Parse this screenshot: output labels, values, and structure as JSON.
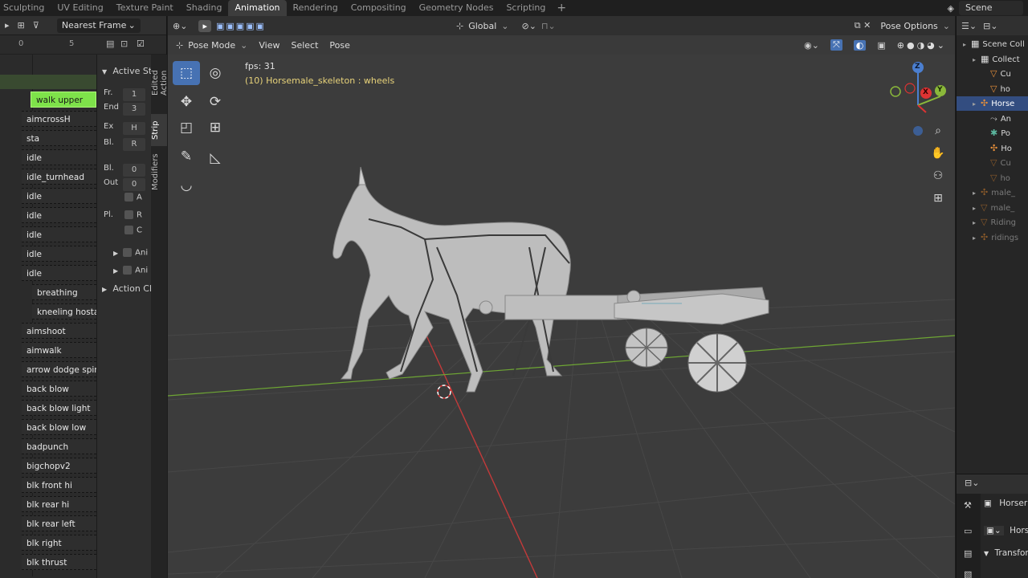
{
  "workspace_tabs": [
    "Sculpting",
    "UV Editing",
    "Texture Paint",
    "Shading",
    "Animation",
    "Rendering",
    "Compositing",
    "Geometry Nodes",
    "Scripting"
  ],
  "active_workspace": "Animation",
  "scene": {
    "label": "Scene"
  },
  "nla": {
    "snap_mode": "Nearest Frame",
    "ruler": [
      "0",
      "5"
    ],
    "tracks": [
      {
        "label": "walk upper",
        "style": "green"
      },
      {
        "label": "aimcrossH",
        "style": "normal"
      },
      {
        "label": "sta",
        "style": "normal"
      },
      {
        "label": "idle",
        "style": "normal"
      },
      {
        "label": "idle_turnhead",
        "style": "normal"
      },
      {
        "label": "idle",
        "style": "normal"
      },
      {
        "label": "idle",
        "style": "normal"
      },
      {
        "label": "idle",
        "style": "normal"
      },
      {
        "label": "idle",
        "style": "normal"
      },
      {
        "label": "idle",
        "style": "normal"
      },
      {
        "label": "breathing",
        "style": "indent"
      },
      {
        "label": "kneeling hostag",
        "style": "indent"
      },
      {
        "label": "aimshoot",
        "style": "normal"
      },
      {
        "label": "aimwalk",
        "style": "normal"
      },
      {
        "label": "arrow dodge spin 2",
        "style": "normal"
      },
      {
        "label": "back blow",
        "style": "normal"
      },
      {
        "label": "back blow light",
        "style": "normal"
      },
      {
        "label": "back blow low",
        "style": "normal"
      },
      {
        "label": "badpunch",
        "style": "normal"
      },
      {
        "label": "bigchopv2",
        "style": "normal"
      },
      {
        "label": "blk front hi",
        "style": "normal"
      },
      {
        "label": "blk rear hi",
        "style": "normal"
      },
      {
        "label": "blk rear left",
        "style": "normal"
      },
      {
        "label": "blk right",
        "style": "normal"
      },
      {
        "label": "blk thrust",
        "style": "normal"
      }
    ],
    "sidebar": {
      "active_strip_label": "Active St",
      "frame_start_label": "Fr.",
      "frame_start": "1",
      "frame_end_label": "End",
      "frame_end": "3",
      "extrapolation_label": "Ex",
      "extrapolation": "H",
      "blending_label": "Bl.",
      "blending": "R",
      "blend_in_label": "Bl.",
      "blend_in": "0",
      "blend_out_label": "Out",
      "blend_out": "0",
      "auto_blend": "A",
      "playback_label": "Pl.",
      "reversed": "R",
      "cyclic": "C",
      "anim1": "Ani",
      "anim2": "Ani",
      "action_clip_label": "Action Cli"
    },
    "vertical_tabs": [
      "Edited Action",
      "Strip",
      "Modifiers"
    ]
  },
  "viewport": {
    "orientation": "Global",
    "pose_options": "Pose Options",
    "mode": "Pose Mode",
    "menu": [
      "View",
      "Select",
      "Pose"
    ],
    "fps": "fps: 31",
    "object_info": "(10) Horsemale_skeleton : wheels",
    "gizmo_axes": {
      "z": "Z",
      "x": "X",
      "y": "Y"
    }
  },
  "outliner": {
    "rows": [
      {
        "label": "Scene Coll",
        "indent": 1,
        "icon": "collection",
        "state": "normal"
      },
      {
        "label": "Collect",
        "indent": 2,
        "icon": "collection",
        "state": "normal"
      },
      {
        "label": "Cu",
        "indent": 3,
        "icon": "mesh",
        "state": "normal"
      },
      {
        "label": "ho",
        "indent": 3,
        "icon": "mesh",
        "state": "normal"
      },
      {
        "label": "Horse",
        "indent": 2,
        "icon": "armature",
        "state": "sel"
      },
      {
        "label": "An",
        "indent": 3,
        "icon": "action",
        "state": "normal"
      },
      {
        "label": "Po",
        "indent": 3,
        "icon": "pose",
        "state": "normal"
      },
      {
        "label": "Ho",
        "indent": 3,
        "icon": "armature",
        "state": "normal"
      },
      {
        "label": "Cu",
        "indent": 3,
        "icon": "mesh",
        "state": "dim"
      },
      {
        "label": "ho",
        "indent": 3,
        "icon": "mesh",
        "state": "dim"
      },
      {
        "label": "male_",
        "indent": 2,
        "icon": "armature",
        "state": "dim"
      },
      {
        "label": "male_",
        "indent": 2,
        "icon": "mesh",
        "state": "dim"
      },
      {
        "label": "Riding",
        "indent": 2,
        "icon": "mesh",
        "state": "dim"
      },
      {
        "label": "ridings",
        "indent": 2,
        "icon": "armature",
        "state": "dim"
      }
    ]
  },
  "properties": {
    "object_name": "Horser",
    "data_name": "Hors",
    "transform_label": "Transfor"
  },
  "colors": {
    "accent": "#4772b3",
    "active_strip": "#7ee24a",
    "x_axis": "#c33a3a",
    "y_axis": "#6ea634",
    "info_text": "#e8d37a"
  }
}
